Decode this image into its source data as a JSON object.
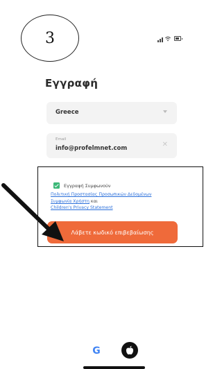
{
  "annotation": {
    "step_number": "3"
  },
  "status_bar": {
    "icons": [
      "signal-icon",
      "wifi-icon",
      "battery-icon"
    ]
  },
  "form": {
    "title": "Εγγραφή",
    "country": {
      "value": "Greece"
    },
    "email": {
      "label": "Email",
      "value": "info@profelmnet.com"
    }
  },
  "agreement": {
    "checkbox_label": "Εγγραφή Συμφωνούν",
    "checked": true,
    "privacy_policy_link": "Πολιτική Προστασίας Προσωπικών Δεδομένων",
    "user_agreement_link": "Συμφωνία Χρήστη",
    "and_text": "και",
    "children_privacy_link": "Children's Privacy Statement"
  },
  "cta": {
    "label": "Λάβετε κωδικό επιβεβαίωσης"
  },
  "social_login": {
    "google_letter": "G"
  },
  "colors": {
    "accent": "#ef6a3a",
    "checkbox": "#3cb878",
    "link": "#2a6fdb",
    "field_background": "#f3f3f3"
  }
}
